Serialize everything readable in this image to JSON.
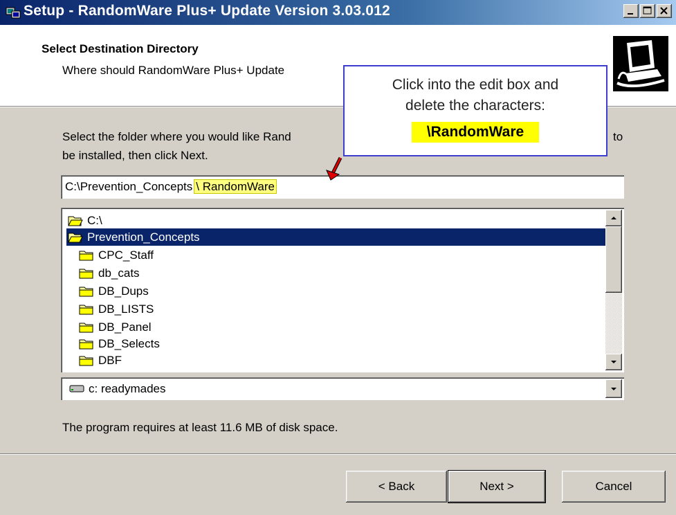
{
  "window": {
    "title": "Setup - RandomWare Plus+ Update Version 3.03.012",
    "controls": [
      "_",
      "□",
      "×"
    ]
  },
  "header": {
    "title": "Select Destination Directory",
    "subtitle": "Where should RandomWare Plus+ Update"
  },
  "callout": {
    "line1": "Click into the edit box and",
    "line2": "delete the characters:",
    "keyword": "\\RandomWare"
  },
  "body": {
    "instruction_line1": "Select the folder where you would like Rand",
    "instruction_line1_end": "to",
    "instruction_line2": "be installed, then click Next."
  },
  "path_input": {
    "value_prefix": "C:\\Prevention_Concepts",
    "value_highlighted": "\\ RandomWare"
  },
  "folder_tree": {
    "items": [
      {
        "label": "C:\\",
        "level": 0,
        "open": true,
        "selected": false
      },
      {
        "label": "Prevention_Concepts",
        "level": 0,
        "open": true,
        "selected": true
      },
      {
        "label": "CPC_Staff",
        "level": 1,
        "open": false,
        "selected": false
      },
      {
        "label": "db_cats",
        "level": 1,
        "open": false,
        "selected": false
      },
      {
        "label": "DB_Dups",
        "level": 1,
        "open": false,
        "selected": false
      },
      {
        "label": "DB_LISTS",
        "level": 1,
        "open": false,
        "selected": false
      },
      {
        "label": "DB_Panel",
        "level": 1,
        "open": false,
        "selected": false
      },
      {
        "label": "DB_Selects",
        "level": 1,
        "open": false,
        "selected": false
      },
      {
        "label": "DBF",
        "level": 1,
        "open": false,
        "selected": false
      }
    ]
  },
  "drive_select": {
    "value": "c: readymades"
  },
  "disk_requirement": "The program requires at least 11.6 MB of disk space.",
  "buttons": {
    "back": "< Back",
    "next": "Next >",
    "cancel": "Cancel"
  },
  "colors": {
    "title_bar": "#0a246a",
    "selection": "#0a246a",
    "highlight": "#ffff00",
    "callout_border": "#3c3ccf"
  }
}
